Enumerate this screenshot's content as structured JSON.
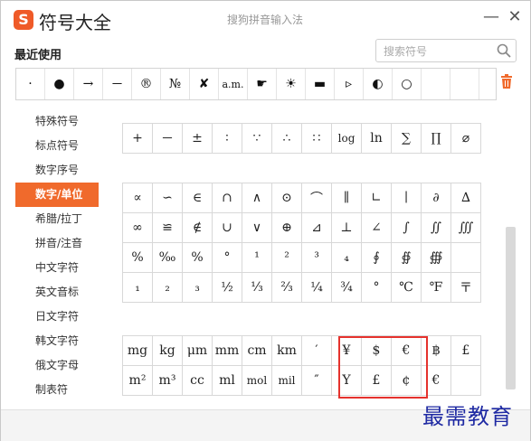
{
  "window": {
    "app_title": "符号大全",
    "logo_letter": "S",
    "center_title": "搜狗拼音输入法",
    "min_label": "—",
    "close_label": "✕"
  },
  "recent": {
    "label": "最近使用",
    "symbols": [
      "·",
      "●",
      "→",
      "－",
      "®",
      "№",
      "✘",
      "a.m.",
      "☛",
      "☀",
      "▬",
      "▹",
      "◐",
      "○",
      "",
      ""
    ]
  },
  "search": {
    "placeholder": "搜索符号"
  },
  "sidebar": {
    "items": [
      "特殊符号",
      "标点符号",
      "数字序号",
      "数字/单位",
      "希腊/拉丁",
      "拼音/注音",
      "中文字符",
      "英文音标",
      "日文字符",
      "韩文字符",
      "俄文字母",
      "制表符"
    ],
    "active_index": 3
  },
  "grids": {
    "top": [
      [
        "+",
        "－",
        "±",
        "∶",
        "∵",
        "∴",
        "∷",
        "log",
        "ln",
        "∑",
        "∏",
        "⌀"
      ]
    ],
    "math": [
      [
        "∝",
        "∽",
        "∈",
        "∩",
        "∧",
        "⊙",
        "⌒",
        "∥",
        "∟",
        "∣",
        "∂",
        "∆"
      ],
      [
        "∞",
        "≌",
        "∉",
        "∪",
        "∨",
        "⊕",
        "⊿",
        "⊥",
        "∠",
        "∫",
        "∬",
        "∭"
      ],
      [
        "%",
        "‰",
        "%",
        "°",
        "¹",
        "²",
        "³",
        "₄",
        "∮",
        "∯",
        "∰",
        ""
      ],
      [
        "₁",
        "₂",
        "₃",
        "½",
        "⅓",
        "⅔",
        "¼",
        "¾",
        "°",
        "℃",
        "℉",
        "〒"
      ]
    ],
    "units": [
      [
        "mg",
        "kg",
        "μm",
        "mm",
        "cm",
        "km",
        "′",
        "¥",
        "$",
        "€",
        "฿",
        "£"
      ],
      [
        "m²",
        "m³",
        "cc",
        "ml",
        "mol",
        "mil",
        "″",
        "Y",
        "£",
        "¢",
        "€",
        ""
      ]
    ]
  },
  "watermark": "最需教育",
  "colors": {
    "accent": "#f06a2c",
    "highlight_border": "#e5322d",
    "watermark": "#1f2aa3"
  }
}
